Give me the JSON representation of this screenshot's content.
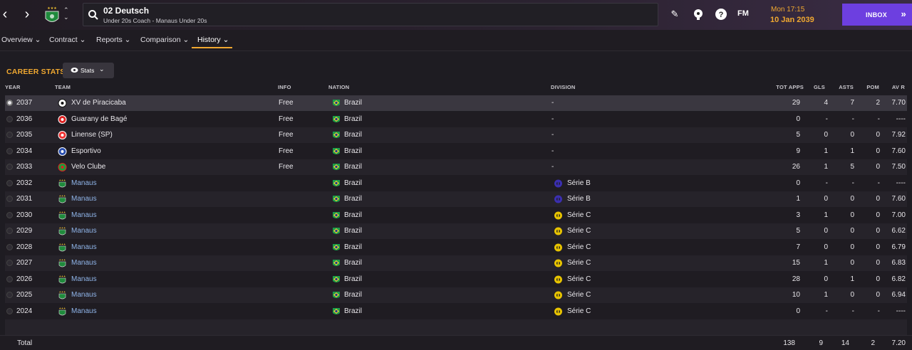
{
  "topbar": {
    "back_icon": "chevron-left-icon",
    "forward_icon": "chevron-right-icon",
    "staff_name": "02 Deutsch",
    "staff_subtitle": "Under 20s Coach - Manaus Under 20s",
    "time": "Mon 17:15",
    "date": "10 Jan 2039",
    "fm_label": "FM",
    "inbox_label": "INBOX",
    "colors": {
      "accent": "#f0a830",
      "inbox": "#6d3fe0",
      "link": "#8fb4e8"
    }
  },
  "tabs": [
    {
      "label": "Overview"
    },
    {
      "label": "Contract"
    },
    {
      "label": "Reports"
    },
    {
      "label": "Comparison"
    },
    {
      "label": "History"
    }
  ],
  "section": {
    "title": "CAREER STATS",
    "view_button": "Stats"
  },
  "columns": {
    "year": "YEAR",
    "team": "TEAM",
    "info": "INFO",
    "nation": "NATION",
    "division": "DIVISION",
    "tot_apps": "TOT APPS",
    "gls": "GLS",
    "asts": "ASTS",
    "pom": "POM",
    "avr": "AV R"
  },
  "rows": [
    {
      "year": "2037",
      "team": "XV de Piracicaba",
      "info": "Free",
      "nation": "Brazil",
      "division": "-",
      "apps": "29",
      "gls": "4",
      "asts": "7",
      "pom": "2",
      "avr": "7.70"
    },
    {
      "year": "2036",
      "team": "Guarany de Bagé",
      "info": "Free",
      "nation": "Brazil",
      "division": "-",
      "apps": "0",
      "gls": "-",
      "asts": "-",
      "pom": "-",
      "avr": "----"
    },
    {
      "year": "2035",
      "team": "Linense (SP)",
      "info": "Free",
      "nation": "Brazil",
      "division": "-",
      "apps": "5",
      "gls": "0",
      "asts": "0",
      "pom": "0",
      "avr": "7.92"
    },
    {
      "year": "2034",
      "team": "Esportivo",
      "info": "Free",
      "nation": "Brazil",
      "division": "-",
      "apps": "9",
      "gls": "1",
      "asts": "1",
      "pom": "0",
      "avr": "7.60"
    },
    {
      "year": "2033",
      "team": "Velo Clube",
      "info": "Free",
      "nation": "Brazil",
      "division": "-",
      "apps": "26",
      "gls": "1",
      "asts": "5",
      "pom": "0",
      "avr": "7.50"
    },
    {
      "year": "2032",
      "team": "Manaus",
      "info": "",
      "nation": "Brazil",
      "division": "Série B",
      "apps": "0",
      "gls": "-",
      "asts": "-",
      "pom": "-",
      "avr": "----"
    },
    {
      "year": "2031",
      "team": "Manaus",
      "info": "",
      "nation": "Brazil",
      "division": "Série B",
      "apps": "1",
      "gls": "0",
      "asts": "0",
      "pom": "0",
      "avr": "7.60"
    },
    {
      "year": "2030",
      "team": "Manaus",
      "info": "",
      "nation": "Brazil",
      "division": "Série C",
      "apps": "3",
      "gls": "1",
      "asts": "0",
      "pom": "0",
      "avr": "7.00"
    },
    {
      "year": "2029",
      "team": "Manaus",
      "info": "",
      "nation": "Brazil",
      "division": "Série C",
      "apps": "5",
      "gls": "0",
      "asts": "0",
      "pom": "0",
      "avr": "6.62"
    },
    {
      "year": "2028",
      "team": "Manaus",
      "info": "",
      "nation": "Brazil",
      "division": "Série C",
      "apps": "7",
      "gls": "0",
      "asts": "0",
      "pom": "0",
      "avr": "6.79"
    },
    {
      "year": "2027",
      "team": "Manaus",
      "info": "",
      "nation": "Brazil",
      "division": "Série C",
      "apps": "15",
      "gls": "1",
      "asts": "0",
      "pom": "0",
      "avr": "6.83"
    },
    {
      "year": "2026",
      "team": "Manaus",
      "info": "",
      "nation": "Brazil",
      "division": "Série C",
      "apps": "28",
      "gls": "0",
      "asts": "1",
      "pom": "0",
      "avr": "6.82"
    },
    {
      "year": "2025",
      "team": "Manaus",
      "info": "",
      "nation": "Brazil",
      "division": "Série C",
      "apps": "10",
      "gls": "1",
      "asts": "0",
      "pom": "0",
      "avr": "6.94"
    },
    {
      "year": "2024",
      "team": "Manaus",
      "info": "",
      "nation": "Brazil",
      "division": "Série C",
      "apps": "0",
      "gls": "-",
      "asts": "-",
      "pom": "-",
      "avr": "----"
    }
  ],
  "total": {
    "label": "Total",
    "apps": "138",
    "gls": "9",
    "asts": "14",
    "pom": "2",
    "avr": "7.20"
  }
}
